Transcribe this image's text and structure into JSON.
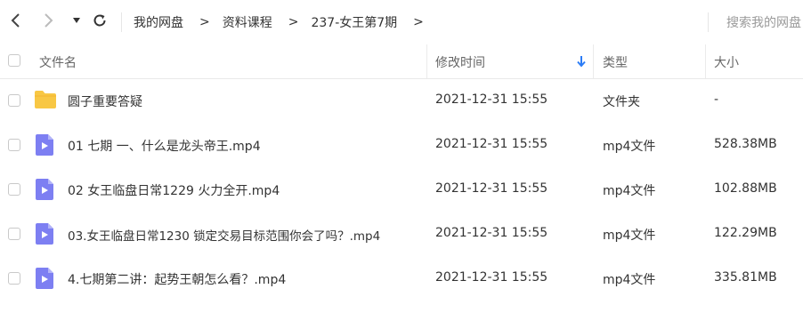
{
  "toolbar": {
    "back_icon": "chevron-left-icon",
    "forward_icon": "chevron-right-icon",
    "dropdown_icon": "caret-down-icon",
    "refresh_icon": "refresh-icon"
  },
  "breadcrumb": {
    "items": [
      "我的网盘",
      "资料课程",
      "237-女王第7期"
    ],
    "separator": ">"
  },
  "search": {
    "placeholder": "搜索我的网盘"
  },
  "table": {
    "headers": {
      "name": "文件名",
      "modified": "修改时间",
      "type": "类型",
      "size": "大小"
    },
    "sort": {
      "column": "modified",
      "direction": "down",
      "color": "#2b7cf6"
    },
    "rows": [
      {
        "icon": "folder-icon",
        "name": "圆子重要答疑",
        "modified": "2021-12-31 15:55",
        "type": "文件夹",
        "size": "-"
      },
      {
        "icon": "video-file-icon",
        "name": "01 七期 一、什么是龙头帝王.mp4",
        "modified": "2021-12-31 15:55",
        "type": "mp4文件",
        "size": "528.38MB"
      },
      {
        "icon": "video-file-icon",
        "name": "02 女王临盘日常1229 火力全开.mp4",
        "modified": "2021-12-31 15:55",
        "type": "mp4文件",
        "size": "102.88MB"
      },
      {
        "icon": "video-file-icon",
        "name": "03.女王临盘日常1230 锁定交易目标范围你会了吗？.mp4",
        "modified": "2021-12-31 15:55",
        "type": "mp4文件",
        "size": "122.29MB"
      },
      {
        "icon": "video-file-icon",
        "name": "4.七期第二讲：起势王朝怎么看？.mp4",
        "modified": "2021-12-31 15:55",
        "type": "mp4文件",
        "size": "335.81MB"
      }
    ]
  },
  "colors": {
    "folder": "#f8c744",
    "video_file": "#7d7ff2",
    "sort_arrow": "#2b7cf6"
  }
}
